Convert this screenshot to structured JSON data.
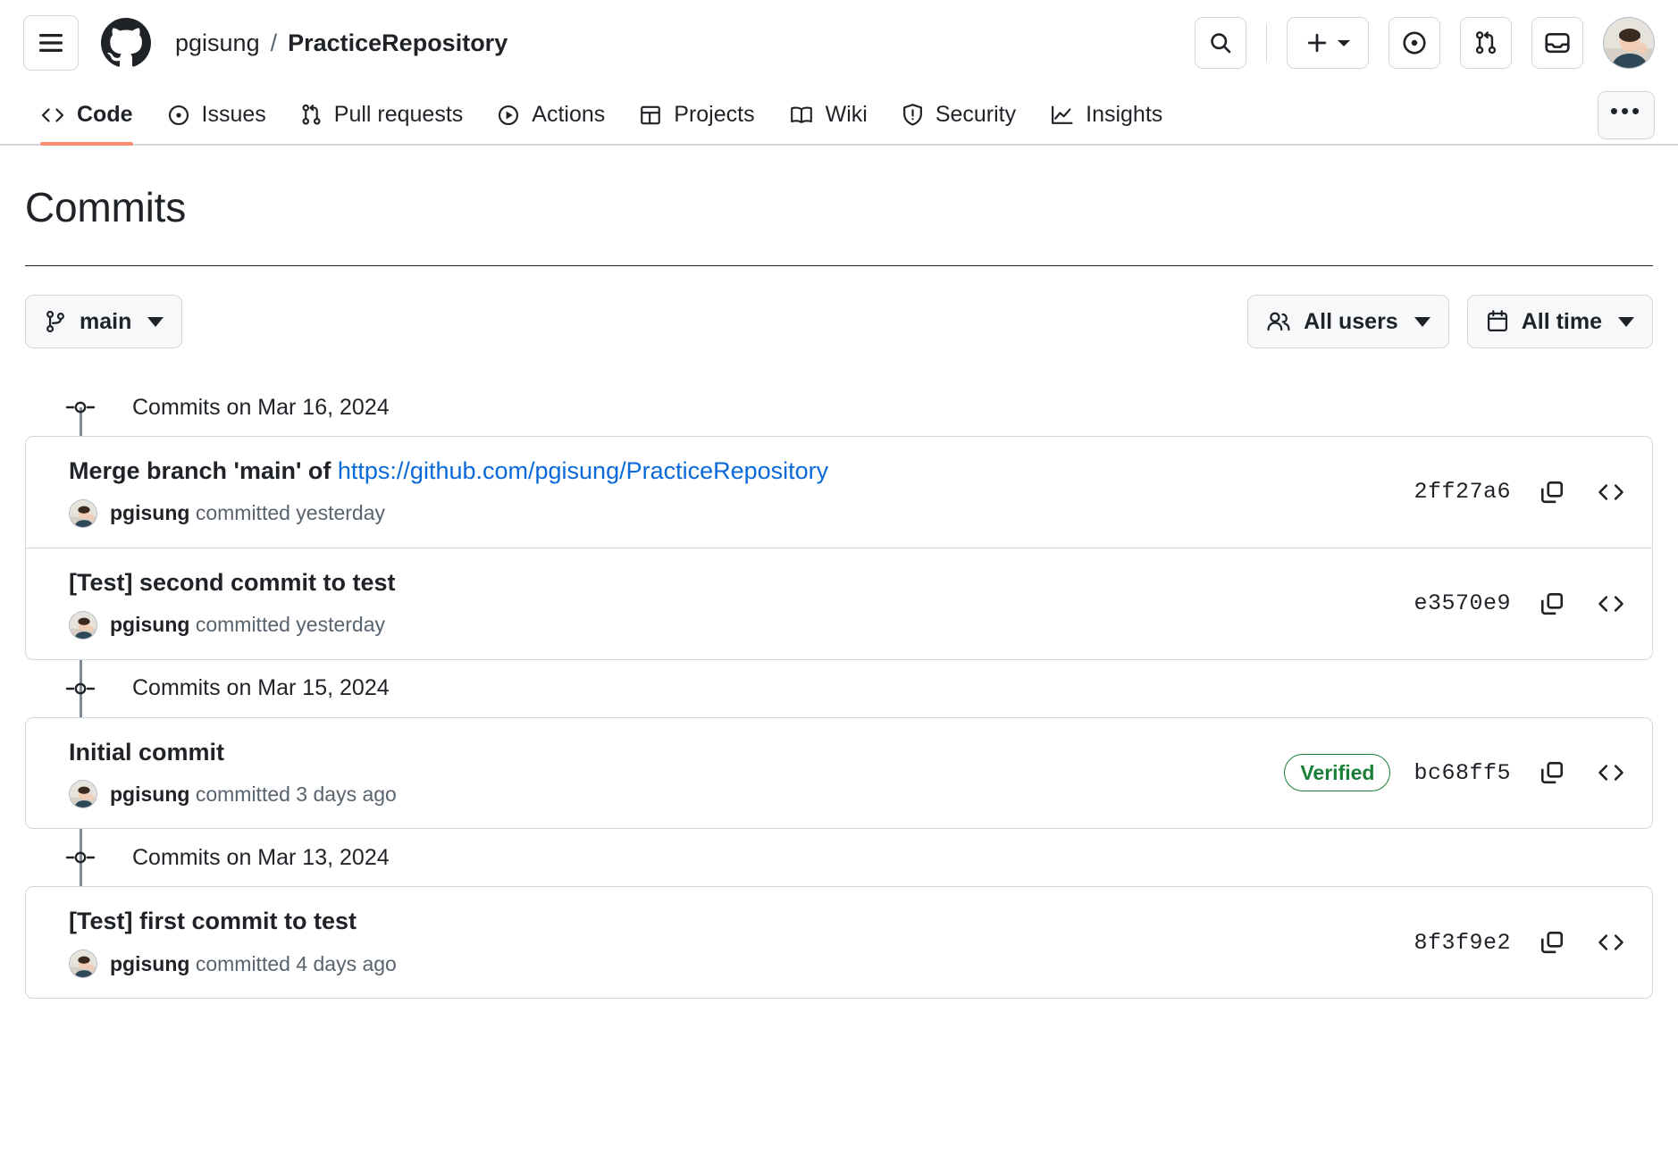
{
  "header": {
    "menu_icon": "hamburger-menu-icon",
    "logo_icon": "github-logo-icon",
    "breadcrumb": {
      "owner": "pgisung",
      "separator": "/",
      "repo": "PracticeRepository"
    },
    "actions": [
      {
        "name": "search-button",
        "icon": "search-icon"
      },
      {
        "name": "create-new-button",
        "icon": "plus-icon"
      },
      {
        "name": "issues-button",
        "icon": "circle-dot-icon"
      },
      {
        "name": "pull-requests-button",
        "icon": "git-pull-request-icon"
      },
      {
        "name": "notifications-button",
        "icon": "inbox-icon"
      }
    ],
    "avatar": "user-avatar"
  },
  "repo_nav": {
    "items": [
      {
        "label": "Code",
        "icon": "code-icon",
        "selected": true
      },
      {
        "label": "Issues",
        "icon": "circle-dot-icon",
        "selected": false
      },
      {
        "label": "Pull requests",
        "icon": "git-pull-request-icon",
        "selected": false
      },
      {
        "label": "Actions",
        "icon": "play-circle-icon",
        "selected": false
      },
      {
        "label": "Projects",
        "icon": "table-icon",
        "selected": false
      },
      {
        "label": "Wiki",
        "icon": "book-icon",
        "selected": false
      },
      {
        "label": "Security",
        "icon": "shield-icon",
        "selected": false
      },
      {
        "label": "Insights",
        "icon": "graph-icon",
        "selected": false
      }
    ],
    "overflow_label": "•••"
  },
  "main": {
    "title": "Commits",
    "branch_selector": {
      "label": "main",
      "icon": "git-branch-icon"
    },
    "filters": [
      {
        "label": "All users",
        "icon": "people-icon",
        "name": "user-filter-button"
      },
      {
        "label": "All time",
        "icon": "calendar-icon",
        "name": "date-filter-button"
      }
    ],
    "groups": [
      {
        "date_label": "Commits on Mar 16, 2024",
        "commits": [
          {
            "title_text": "Merge branch 'main' of ",
            "title_link": "https://github.com/pgisung/PracticeRepository",
            "author": "pgisung",
            "meta_suffix": " committed yesterday",
            "verified": null,
            "sha": "2ff27a6"
          },
          {
            "title_text": "[Test] second commit to test",
            "title_link": null,
            "author": "pgisung",
            "meta_suffix": " committed yesterday",
            "verified": null,
            "sha": "e3570e9"
          }
        ]
      },
      {
        "date_label": "Commits on Mar 15, 2024",
        "commits": [
          {
            "title_text": "Initial commit",
            "title_link": null,
            "author": "pgisung",
            "meta_suffix": " committed 3 days ago",
            "verified": "Verified",
            "sha": "bc68ff5"
          }
        ]
      },
      {
        "date_label": "Commits on Mar 13, 2024",
        "commits": [
          {
            "title_text": "[Test] first commit to test",
            "title_link": null,
            "author": "pgisung",
            "meta_suffix": " committed 4 days ago",
            "verified": null,
            "sha": "8f3f9e2"
          }
        ]
      }
    ],
    "row_actions": {
      "copy_icon": "copy-icon",
      "browse_icon": "code-brackets-icon"
    }
  },
  "colors": {
    "link": "#0969da",
    "verified": "#1a7f37",
    "border": "#d1d9e0",
    "muted_text": "#59636e",
    "timeline_line": "#818b98",
    "selected_tab_underline": "#fd8c73"
  }
}
